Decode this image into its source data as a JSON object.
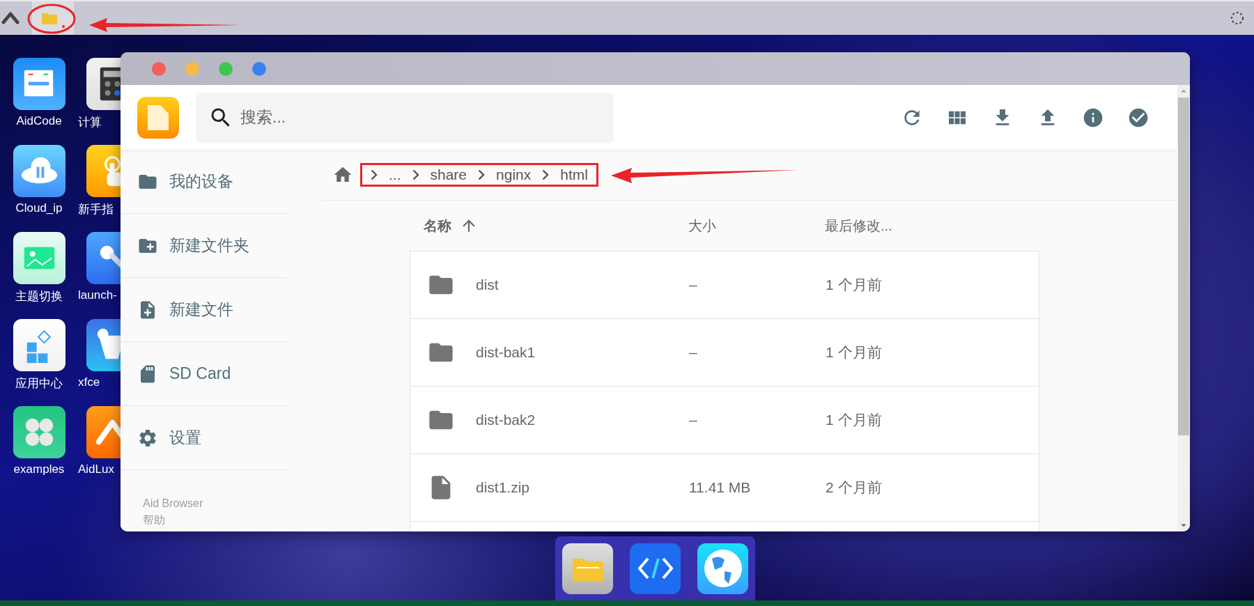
{
  "desktop_icons": [
    {
      "label": "AidCode",
      "kind": "python"
    },
    {
      "label": "计算",
      "kind": "calculator"
    },
    {
      "label": "Cloud_ip",
      "kind": "cloud"
    },
    {
      "label": "新手指",
      "kind": "hand"
    },
    {
      "label": "主题切换",
      "kind": "image"
    },
    {
      "label": "launch-",
      "kind": "tools"
    },
    {
      "label": "应用中心",
      "kind": "apps"
    },
    {
      "label": "xfce",
      "kind": "mouse"
    },
    {
      "label": "examples",
      "kind": "clover"
    },
    {
      "label": "AidLux",
      "kind": "aidlux"
    }
  ],
  "window": {
    "search": {
      "placeholder": "搜索..."
    },
    "breadcrumb": [
      "...",
      "share",
      "nginx",
      "html"
    ],
    "sidebar": {
      "items": [
        {
          "label": "我的设备",
          "kind": "folder"
        },
        {
          "label": "新建文件夹",
          "kind": "new-folder"
        },
        {
          "label": "新建文件",
          "kind": "new-file"
        },
        {
          "label": "SD Card",
          "kind": "sd"
        },
        {
          "label": "设置",
          "kind": "settings"
        }
      ],
      "footer": [
        "Aid Browser",
        "帮助"
      ]
    },
    "table": {
      "columns": [
        "名称",
        "大小",
        "最后修改..."
      ],
      "rows": [
        {
          "name": "dist",
          "size": "–",
          "modified": "1 个月前",
          "kind": "folder"
        },
        {
          "name": "dist-bak1",
          "size": "–",
          "modified": "1 个月前",
          "kind": "folder"
        },
        {
          "name": "dist-bak2",
          "size": "–",
          "modified": "1 个月前",
          "kind": "folder"
        },
        {
          "name": "dist1.zip",
          "size": "11.41 MB",
          "modified": "2 个月前",
          "kind": "file"
        }
      ]
    }
  },
  "dock": [
    {
      "kind": "files"
    },
    {
      "kind": "code"
    },
    {
      "kind": "browser"
    }
  ]
}
